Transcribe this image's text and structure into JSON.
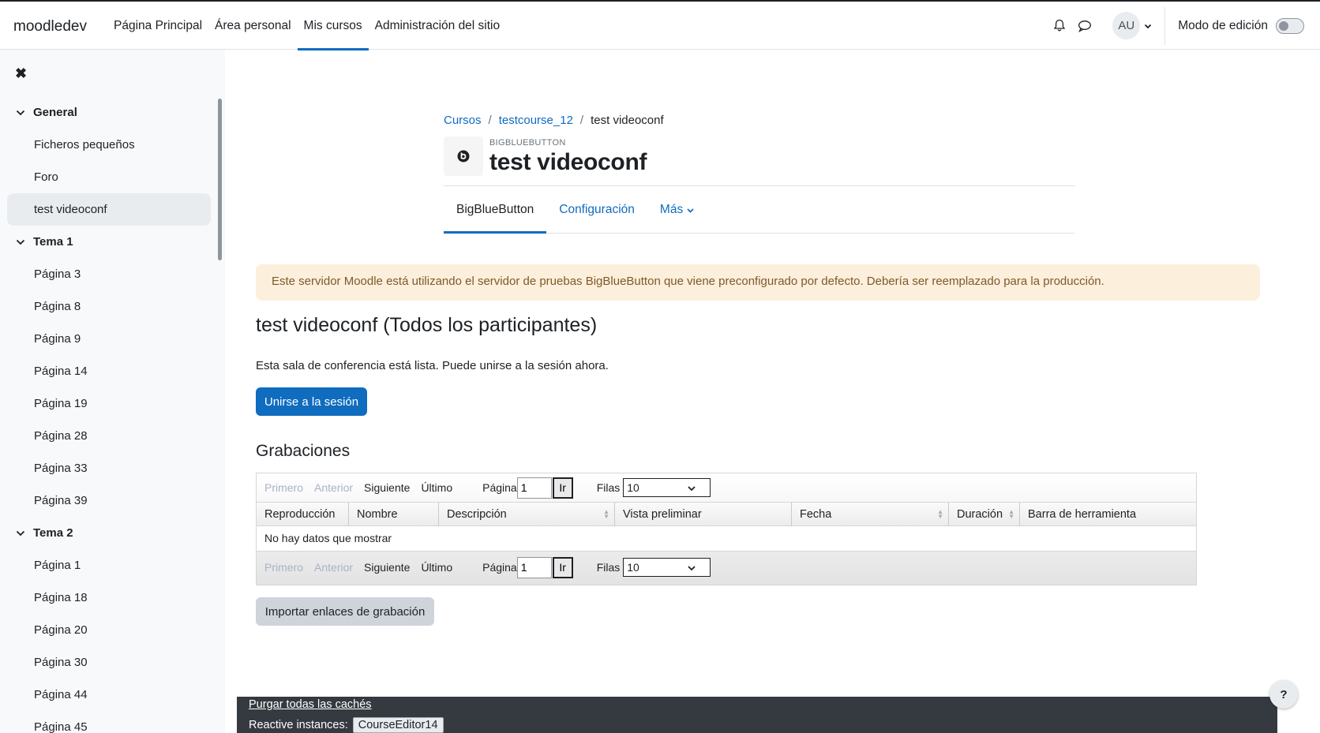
{
  "navbar": {
    "brand": "moodledev",
    "items": [
      {
        "label": "Página Principal",
        "active": false
      },
      {
        "label": "Área personal",
        "active": false
      },
      {
        "label": "Mis cursos",
        "active": true
      },
      {
        "label": "Administración del sitio",
        "active": false
      }
    ],
    "avatar_initials": "AU",
    "edit_mode_label": "Modo de edición",
    "edit_mode_on": false,
    "icons": [
      "bell-icon",
      "chat-icon"
    ]
  },
  "drawer": {
    "close_icon": "close-icon",
    "sections": [
      {
        "title": "General",
        "items": [
          "Ficheros pequeños",
          "Foro",
          "test videoconf"
        ]
      },
      {
        "title": "Tema 1",
        "items": [
          "Página 3",
          "Página 8",
          "Página 9",
          "Página 14",
          "Página 19",
          "Página 28",
          "Página 33",
          "Página 39"
        ]
      },
      {
        "title": "Tema 2",
        "items": [
          "Página 1",
          "Página 18",
          "Página 20",
          "Página 30",
          "Página 44",
          "Página 45"
        ]
      }
    ],
    "active_item": "test videoconf"
  },
  "breadcrumb": [
    "Cursos",
    "testcourse_12",
    "test videoconf"
  ],
  "activity": {
    "type": "BIGBLUEBUTTON",
    "title": "test videoconf",
    "icon": "bigbluebutton-icon"
  },
  "secondary_nav": {
    "tabs": [
      "BigBlueButton",
      "Configuración",
      "Más"
    ],
    "active": "BigBlueButton"
  },
  "alert": {
    "text": "Este servidor Moodle está utilizando el servidor de pruebas BigBlueButton que viene preconfigurado por defecto. Debería ser reemplazado para la producción.",
    "color": "#fcefdc"
  },
  "room": {
    "title": "test videoconf (Todos los participantes)",
    "status": "Esta sala de conferencia está lista. Puede unirse a la sesión ahora.",
    "join_button": "Unirse a la sesión"
  },
  "recordings": {
    "title": "Grabaciones",
    "pager": {
      "first": "Primero",
      "prev": "Anterior",
      "next": "Siguiente",
      "last": "Último",
      "page_label": "Página",
      "page_value": "1",
      "go": "Ir",
      "rows_label": "Filas",
      "rows_value": "10"
    },
    "columns": [
      "Reproducción",
      "Nombre",
      "Descripción",
      "Vista preliminar",
      "Fecha",
      "Duración",
      "Barra de herramienta"
    ],
    "empty_message": "No hay datos que mostrar",
    "import_button": "Importar enlaces de grabación"
  },
  "footer": {
    "purge_link": "Purgar todas las cachés",
    "reactive_label": "Reactive instances:",
    "reactive_chip": "CourseEditor14"
  },
  "help_button": "?",
  "colors": {
    "primary": "#0f6cbf",
    "alert_bg": "#fcefdc",
    "footer_bg": "#343a40"
  }
}
